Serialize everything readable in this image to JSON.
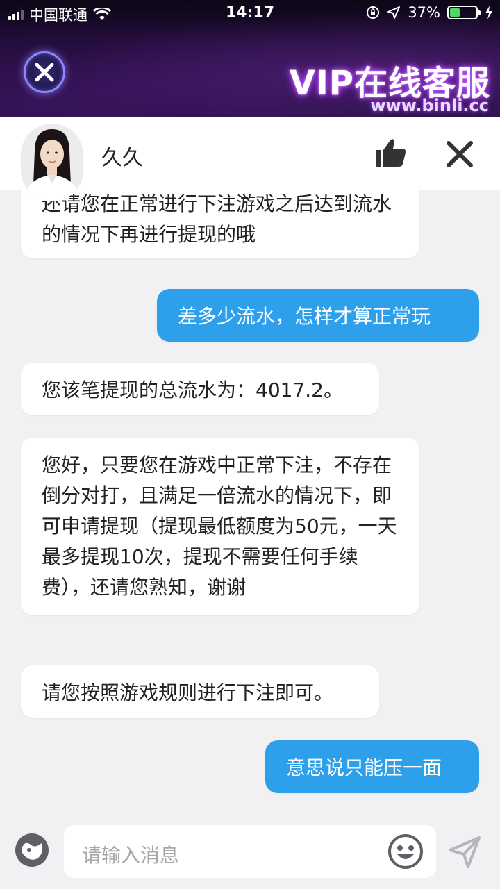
{
  "status_bar": {
    "carrier": "中国联通",
    "time": "14:17",
    "battery_percent": "37%",
    "battery_level": 0.37,
    "icons": [
      "signal-icon",
      "wifi-icon",
      "orientation-lock-icon",
      "location-icon",
      "battery-icon",
      "charging-icon"
    ]
  },
  "banner": {
    "title": "VIP在线客服",
    "url": "www.binli.cc"
  },
  "agent": {
    "name": "久久"
  },
  "messages": [
    {
      "from": "agent",
      "text": "还请您在正常进行下注游戏之后达到流水的情况下再进行提现的哦"
    },
    {
      "from": "user",
      "text": "差多少流水，怎样才算正常玩"
    },
    {
      "from": "agent",
      "text": "您该笔提现的总流水为：4017.2。"
    },
    {
      "from": "agent",
      "text": "您好，只要您在游戏中正常下注，不存在倒分对打，且满足一倍流水的情况下，即可申请提现（提现最低额度为50元，一天最多提现10次，提现不需要任何手续费），还请您熟知，谢谢"
    },
    {
      "from": "agent",
      "text": "请您按照游戏规则进行下注即可。"
    },
    {
      "from": "user",
      "text": "意思说只能压一面"
    }
  ],
  "input": {
    "placeholder": "请输入消息"
  },
  "colors": {
    "user_bubble": "#2ea0eb",
    "agent_bubble": "#ffffff",
    "background": "#f1f1f3",
    "banner_glow": "#c056ff"
  }
}
